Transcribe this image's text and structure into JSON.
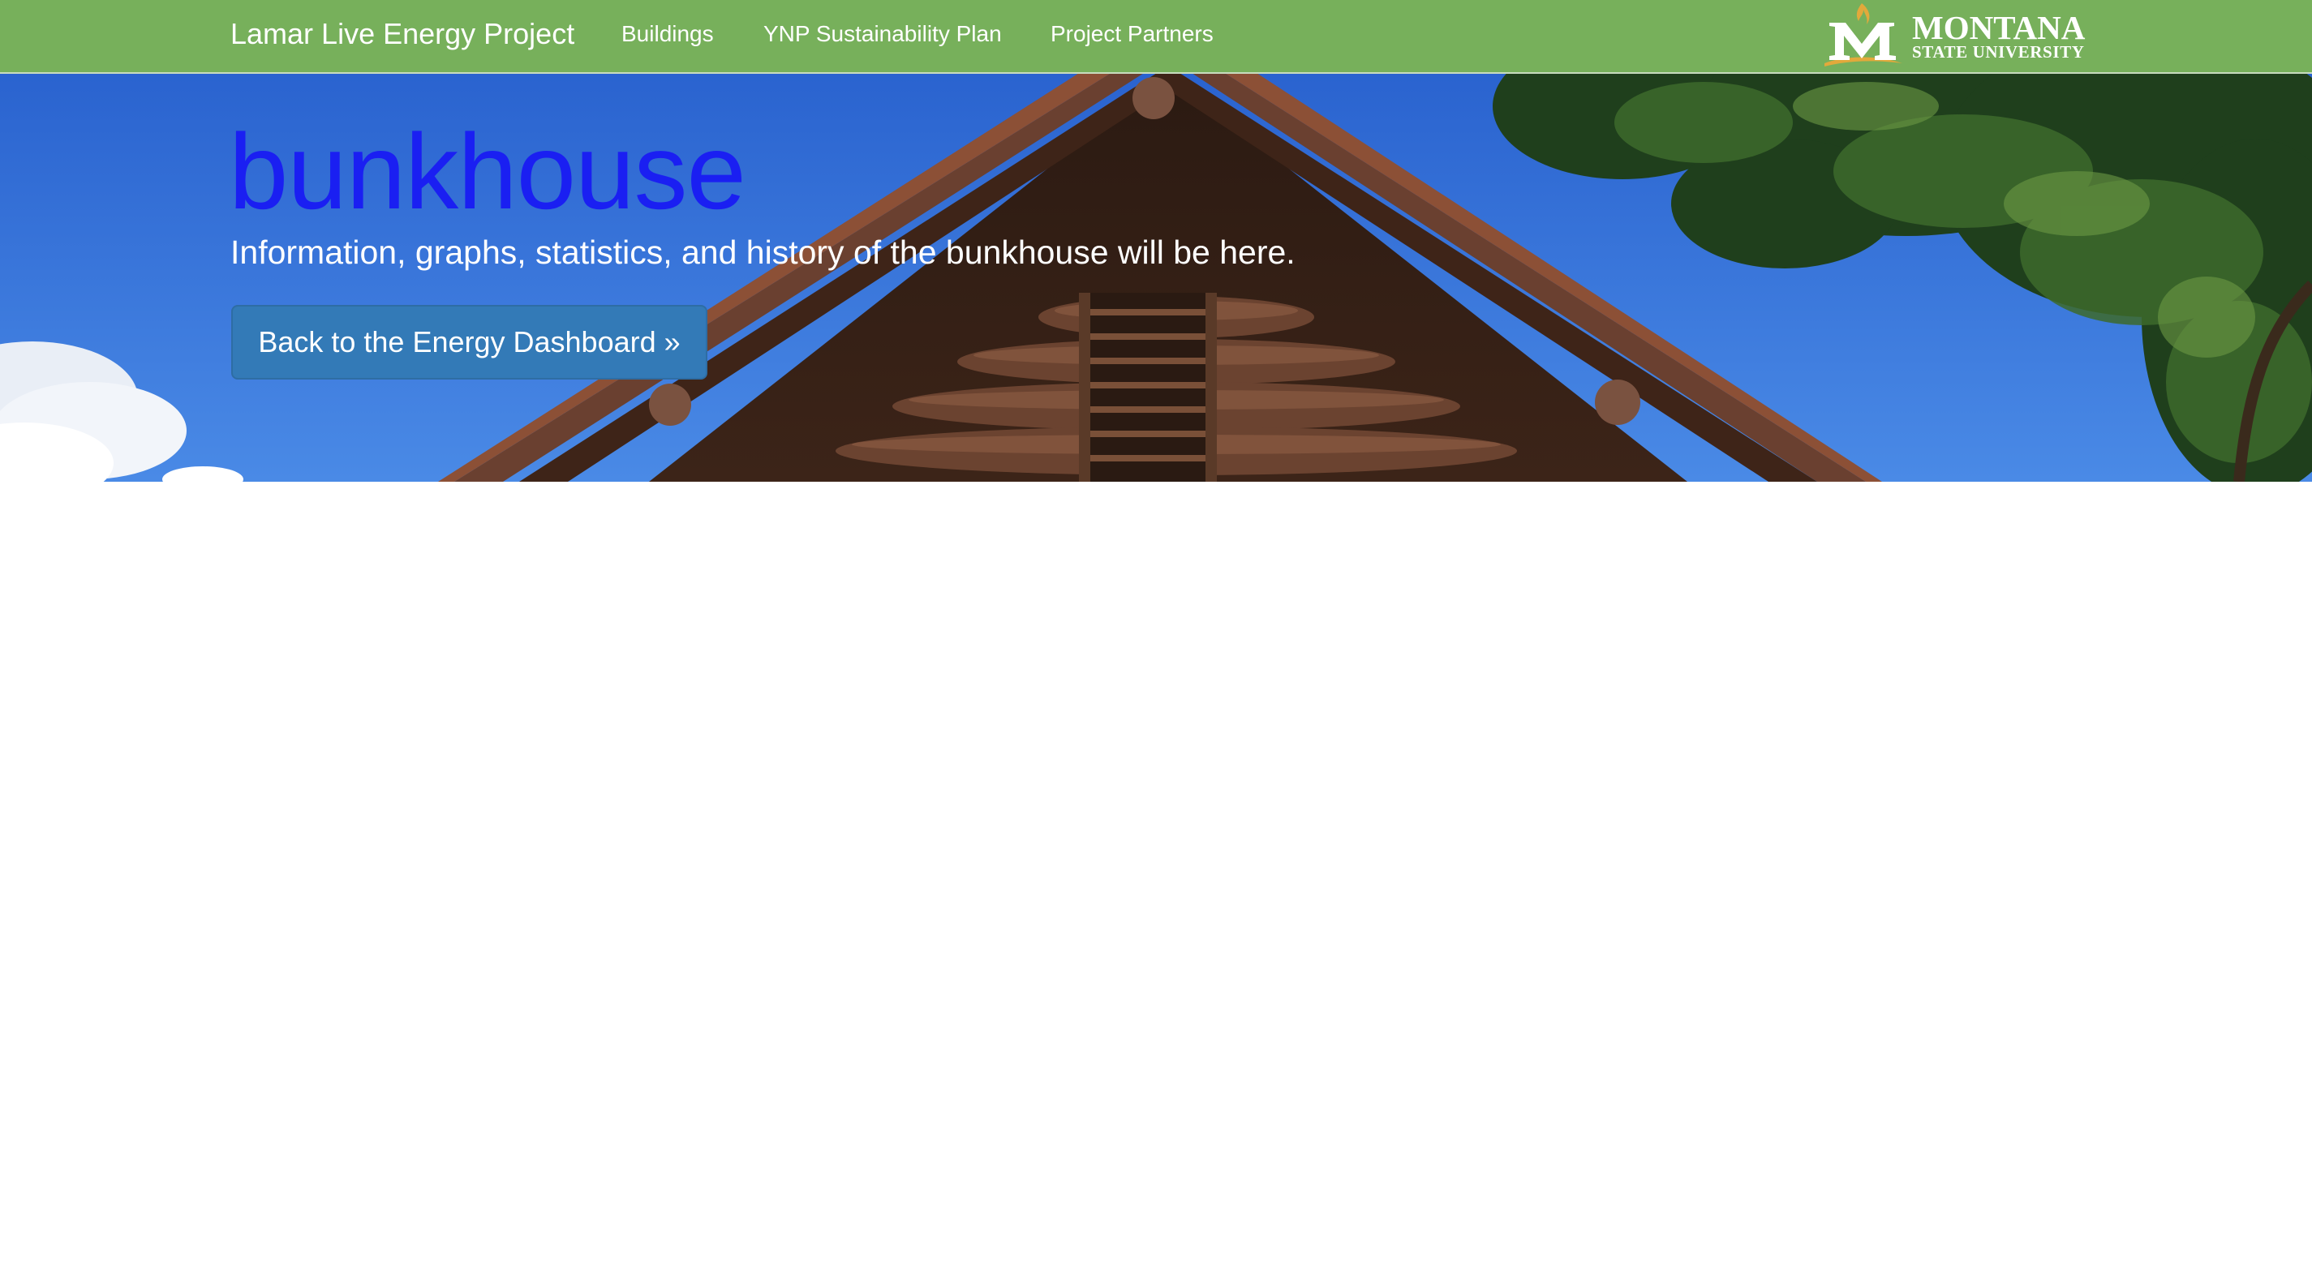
{
  "navbar": {
    "brand": "Lamar Live Energy Project",
    "links": [
      {
        "label": "Buildings"
      },
      {
        "label": "YNP Sustainability Plan"
      },
      {
        "label": "Project Partners"
      }
    ],
    "logo": {
      "line1": "MONTANA",
      "line2": "STATE UNIVERSITY",
      "icon": "msu-m-logo-icon"
    },
    "background_color": "#77b05b"
  },
  "hero": {
    "title": "bunkhouse",
    "subtitle": "Information, graphs, statistics, and history of the bunkhouse will be here.",
    "button_label": "Back to the Energy Dashboard »",
    "title_color": "#1a1ff2",
    "button_color": "#337ab7"
  }
}
